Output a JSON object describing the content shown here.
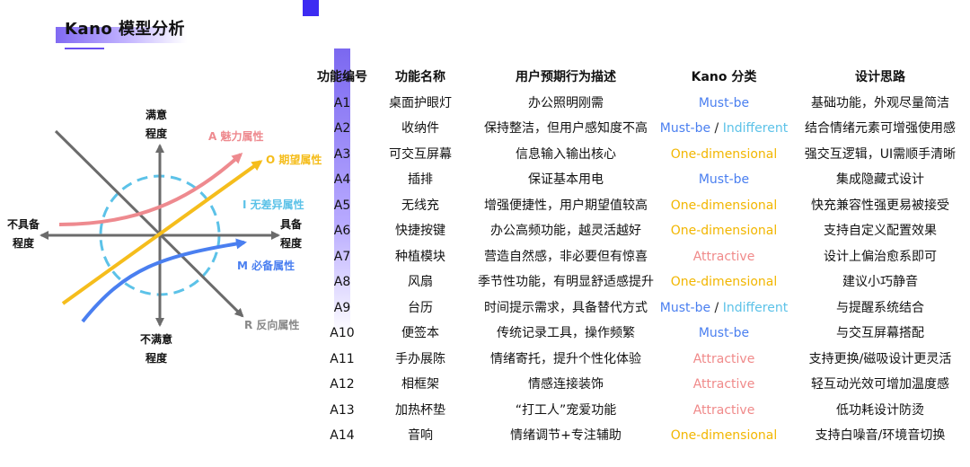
{
  "title": "Kano 模型分析",
  "diagram": {
    "y_top": "满意\n程度",
    "y_bottom": "不满意\n程度",
    "x_left": "不具备\n程度",
    "x_right": "具备\n程度",
    "label_a": "A 魅力属性",
    "label_o": "O 期望属性",
    "label_i": "I 无差异属性",
    "label_m": "M 必备属性",
    "label_r": "R 反向属性",
    "colors": {
      "a": "#ee8a8f",
      "o": "#f5bd1c",
      "i": "#5cc2e8",
      "m": "#4a7ff0",
      "axis": "#6b6b6b"
    }
  },
  "table": {
    "headers": [
      "功能编号",
      "功能名称",
      "用户预期行为描述",
      "Kano 分类",
      "设计思路"
    ],
    "rows": [
      {
        "id": "A1",
        "name": "桌面护眼灯",
        "desc": "办公照明刚需",
        "kano": [
          {
            "text": "Must-be",
            "type": "must"
          }
        ],
        "idea": "基础功能，外观尽量简洁"
      },
      {
        "id": "A2",
        "name": "收纳件",
        "desc": "保持整洁，但用户感知度不高",
        "kano": [
          {
            "text": "Must-be",
            "type": "must"
          },
          {
            "text": " / ",
            "type": "sep"
          },
          {
            "text": "Indifferent",
            "type": "ind"
          }
        ],
        "idea": "结合情绪元素可增强使用感"
      },
      {
        "id": "A3",
        "name": "可交互屏幕",
        "desc": "信息输入输出核心",
        "kano": [
          {
            "text": "One-dimensional",
            "type": "one"
          }
        ],
        "idea": "强交互逻辑，UI需顺手清晰"
      },
      {
        "id": "A4",
        "name": "插排",
        "desc": "保证基本用电",
        "kano": [
          {
            "text": "Must-be",
            "type": "must"
          }
        ],
        "idea": "集成隐藏式设计"
      },
      {
        "id": "A5",
        "name": "无线充",
        "desc": "增强便捷性，用户期望值较高",
        "kano": [
          {
            "text": "One-dimensional",
            "type": "one"
          }
        ],
        "idea": "快充兼容性强更易被接受"
      },
      {
        "id": "A6",
        "name": "快捷按键",
        "desc": "办公高频功能，越灵活越好",
        "kano": [
          {
            "text": "One-dimensional",
            "type": "one"
          }
        ],
        "idea": "支持自定义配置效果"
      },
      {
        "id": "A7",
        "name": "种植模块",
        "desc": "营造自然感，非必要但有惊喜",
        "kano": [
          {
            "text": "Attractive",
            "type": "att"
          }
        ],
        "idea": "设计上偏治愈系即可"
      },
      {
        "id": "A8",
        "name": "风扇",
        "desc": "季节性功能，有明显舒适感提升",
        "kano": [
          {
            "text": "One-dimensional",
            "type": "one"
          }
        ],
        "idea": "建议小巧静音"
      },
      {
        "id": "A9",
        "name": "台历",
        "desc": "时间提示需求，具备替代方式",
        "kano": [
          {
            "text": "Must-be",
            "type": "must"
          },
          {
            "text": " / ",
            "type": "sep"
          },
          {
            "text": "Indifferent",
            "type": "ind"
          }
        ],
        "idea": "与提醒系统结合"
      },
      {
        "id": "A10",
        "name": "便签本",
        "desc": "传统记录工具，操作频繁",
        "kano": [
          {
            "text": "Must-be",
            "type": "must"
          }
        ],
        "idea": "与交互屏幕搭配"
      },
      {
        "id": "A11",
        "name": "手办展陈",
        "desc": "情绪寄托，提升个性化体验",
        "kano": [
          {
            "text": "Attractive",
            "type": "att"
          }
        ],
        "idea": "支持更换/磁吸设计更灵活"
      },
      {
        "id": "A12",
        "name": "相框架",
        "desc": "情感连接装饰",
        "kano": [
          {
            "text": "Attractive",
            "type": "att"
          }
        ],
        "idea": "轻互动光效可增加温度感"
      },
      {
        "id": "A13",
        "name": "加热杯垫",
        "desc": "“打工人”宠爱功能",
        "kano": [
          {
            "text": "Attractive",
            "type": "att"
          }
        ],
        "idea": "低功耗设计防烫"
      },
      {
        "id": "A14",
        "name": "音响",
        "desc": "情绪调节+专注辅助",
        "kano": [
          {
            "text": "One-dimensional",
            "type": "one"
          }
        ],
        "idea": "支持白噪音/环境音切换"
      }
    ]
  }
}
